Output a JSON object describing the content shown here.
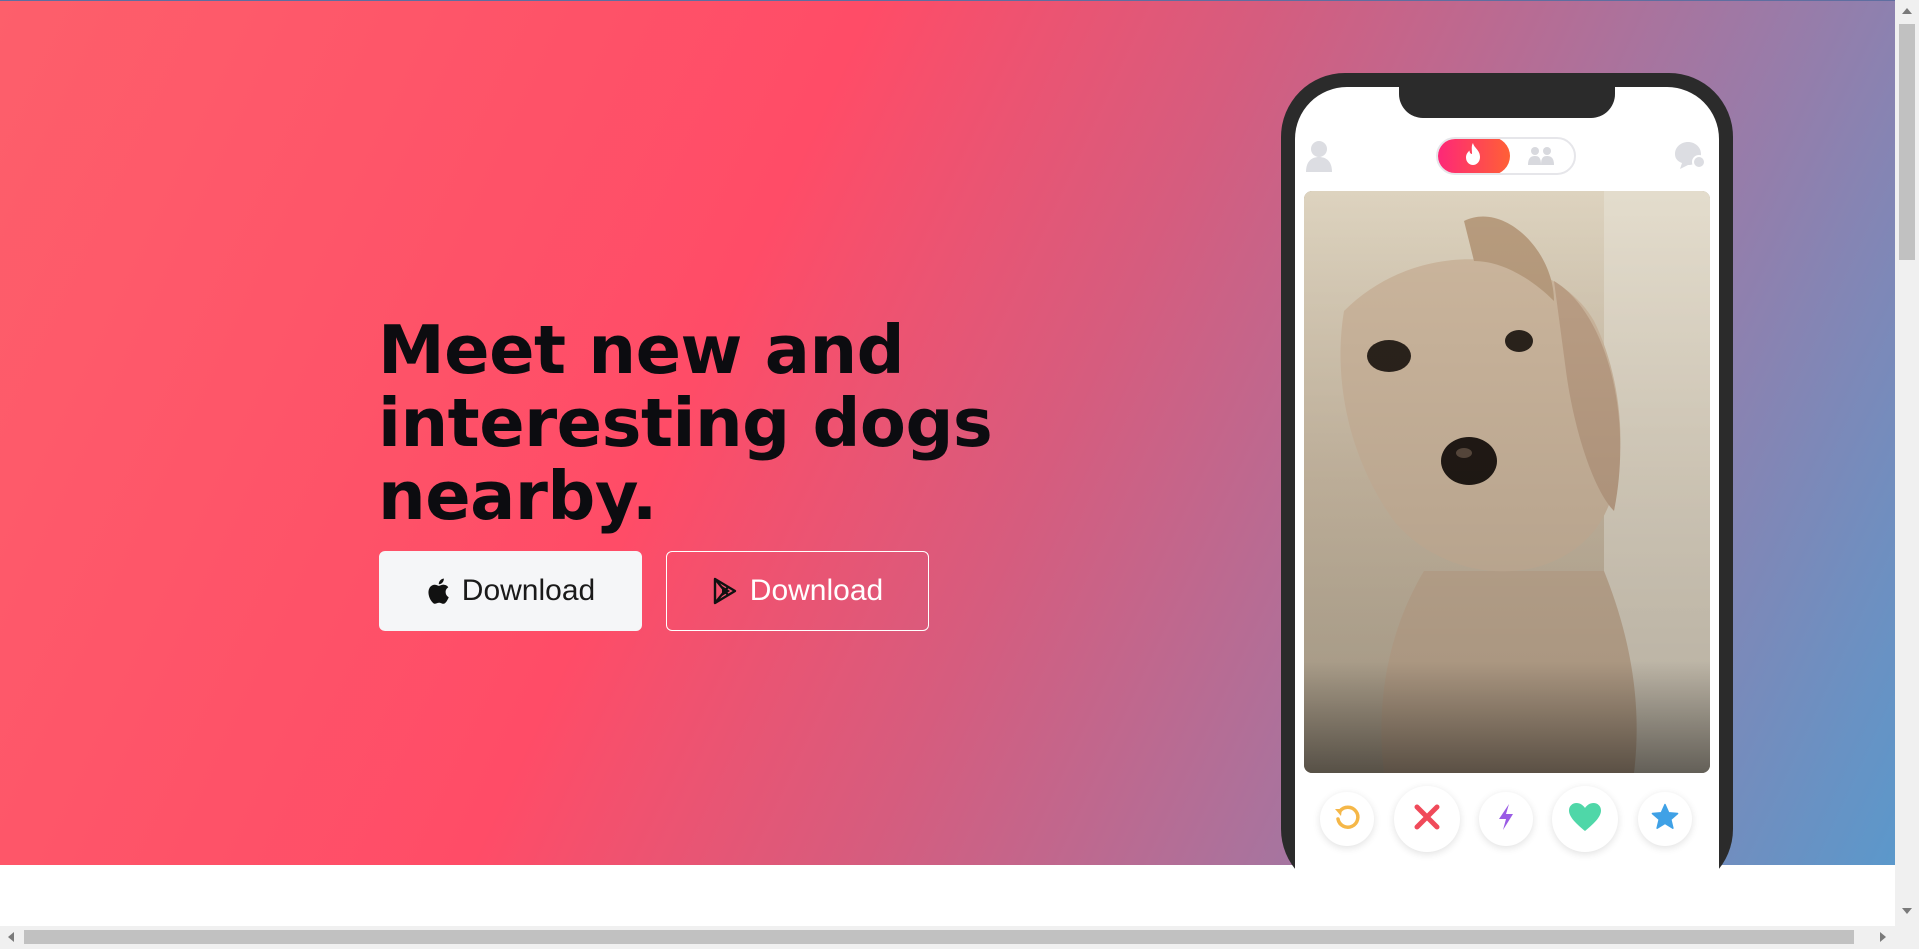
{
  "hero": {
    "headline": "Meet new and interesting dogs nearby.",
    "apple_button_label": "Download",
    "play_button_label": "Download"
  },
  "phone": {
    "toggle_state": "swipe",
    "actions": [
      "rewind-icon",
      "nope-icon",
      "boost-icon",
      "like-icon",
      "super-like-icon"
    ]
  },
  "colors": {
    "gradient_start": "#fd5f6b",
    "gradient_mid": "#ff4c67",
    "gradient_end": "#5b98cb",
    "toggle_accent": "#fd267a"
  }
}
